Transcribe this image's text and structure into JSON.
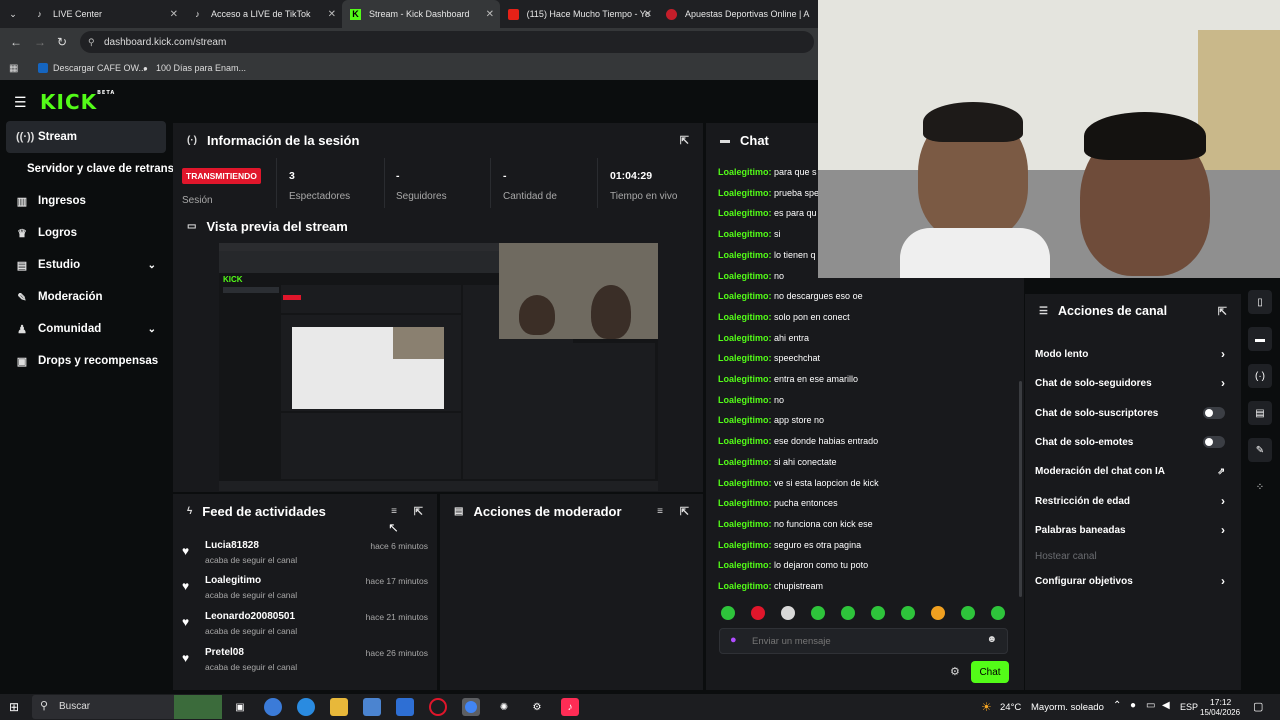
{
  "browser": {
    "tabs": [
      {
        "label": "LIVE Center",
        "icon": "tiktok-icon"
      },
      {
        "label": "Acceso a LIVE de TikTok",
        "icon": "tiktok-icon"
      },
      {
        "label": "Stream - Kick Dashboard",
        "icon": "kick-icon"
      },
      {
        "label": "(115) Hace Mucho Tiempo - Yo",
        "icon": "youtube-icon"
      },
      {
        "label": "Apuestas Deportivas Online | A",
        "icon": "betting-icon"
      }
    ],
    "url": "dashboard.kick.com/stream",
    "bookmarks": [
      "Descargar CAFE OW...",
      "100 Días para Enam..."
    ]
  },
  "brand": {
    "logo": "KICK",
    "beta": "BETA",
    "accent": "#53fc18"
  },
  "sidebar": {
    "items": [
      {
        "label": "Stream",
        "icon": "stream-icon",
        "active": true
      },
      {
        "label": "Servidor y clave de retransmisión",
        "icon": "",
        "active": false
      },
      {
        "label": "Ingresos",
        "icon": "chart-icon"
      },
      {
        "label": "Logros",
        "icon": "trophy-icon"
      },
      {
        "label": "Estudio",
        "icon": "studio-icon"
      },
      {
        "label": "Moderación",
        "icon": "wrench-icon"
      },
      {
        "label": "Comunidad",
        "icon": "community-icon"
      },
      {
        "label": "Drops y recompensas",
        "icon": "gift-icon"
      }
    ]
  },
  "session": {
    "title": "Información de la sesión",
    "status_badge": "TRANSMITIENDO",
    "status_label": "Sesión",
    "stats": [
      {
        "value": "3",
        "label": "Espectadores"
      },
      {
        "value": "-",
        "label": "Seguidores"
      },
      {
        "value": "-",
        "label": "Cantidad de"
      },
      {
        "value": "01:04:29",
        "label": "Tiempo en vivo"
      }
    ]
  },
  "preview": {
    "title": "Vista previa del stream"
  },
  "feed": {
    "title": "Feed de actividades",
    "items": [
      {
        "name": "Lucia81828",
        "action": "acaba de seguir el canal",
        "time": "hace 6 minutos"
      },
      {
        "name": "Loalegitimo",
        "action": "acaba de seguir el canal",
        "time": "hace 17 minutos"
      },
      {
        "name": "Leonardo20080501",
        "action": "acaba de seguir el canal",
        "time": "hace 21 minutos"
      },
      {
        "name": "Pretel08",
        "action": "acaba de seguir el canal",
        "time": "hace 26 minutos"
      }
    ]
  },
  "mod_actions": {
    "title": "Acciones de moderador"
  },
  "chat": {
    "title": "Chat",
    "messages": [
      {
        "user": "Loalegitimo:",
        "text": "para que s"
      },
      {
        "user": "Loalegitimo:",
        "text": "prueba spe"
      },
      {
        "user": "Loalegitimo:",
        "text": "es para qu"
      },
      {
        "user": "Loalegitimo:",
        "text": "si"
      },
      {
        "user": "Loalegitimo:",
        "text": "lo tienen q"
      },
      {
        "user": "Loalegitimo:",
        "text": "no"
      },
      {
        "user": "Loalegitimo:",
        "text": "no descargues eso oe"
      },
      {
        "user": "Loalegitimo:",
        "text": "solo pon en conect"
      },
      {
        "user": "Loalegitimo:",
        "text": "ahi entra"
      },
      {
        "user": "Loalegitimo:",
        "text": "speechchat"
      },
      {
        "user": "Loalegitimo:",
        "text": "entra en ese amarillo"
      },
      {
        "user": "Loalegitimo:",
        "text": "no"
      },
      {
        "user": "Loalegitimo:",
        "text": "app store no"
      },
      {
        "user": "Loalegitimo:",
        "text": "ese donde habias entrado"
      },
      {
        "user": "Loalegitimo:",
        "text": "si ahi conectate"
      },
      {
        "user": "Loalegitimo:",
        "text": "ve si esta laopcion de kick"
      },
      {
        "user": "Loalegitimo:",
        "text": "pucha entonces"
      },
      {
        "user": "Loalegitimo:",
        "text": "no funciona con kick ese"
      },
      {
        "user": "Loalegitimo:",
        "text": "seguro es otra pagina"
      },
      {
        "user": "Loalegitimo:",
        "text": "lo dejaron como tu poto"
      },
      {
        "user": "Loalegitimo:",
        "text": "chupistream"
      }
    ],
    "input_placeholder": "Enviar un mensaje",
    "send_label": "Chat"
  },
  "channel_actions": {
    "title": "Acciones de canal",
    "items": [
      {
        "label": "Modo lento",
        "control": "arrow"
      },
      {
        "label": "Chat de solo-seguidores",
        "control": "arrow"
      },
      {
        "label": "Chat de solo-suscriptores",
        "control": "toggle"
      },
      {
        "label": "Chat de solo-emotes",
        "control": "toggle"
      },
      {
        "label": "Moderación del chat con IA",
        "control": "external"
      },
      {
        "label": "Restricción de edad",
        "control": "arrow"
      },
      {
        "label": "Palabras baneadas",
        "control": "arrow"
      },
      {
        "label": "Hostear canal",
        "control": "disabled"
      },
      {
        "label": "Configurar objetivos",
        "control": "arrow"
      }
    ]
  },
  "taskbar": {
    "search": "Buscar",
    "weather_temp": "24°C",
    "weather_text": "Mayorm. soleado",
    "lang": "ESP",
    "time": "17:12",
    "date": "15/04/2026"
  }
}
